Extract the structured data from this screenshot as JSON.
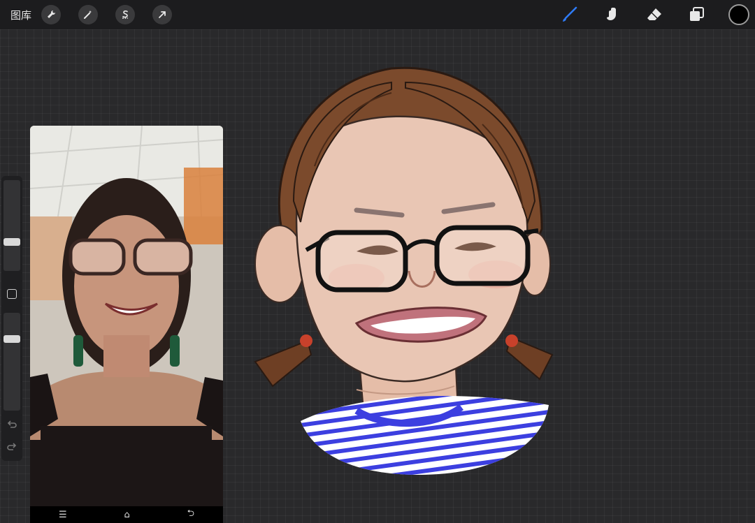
{
  "topbar": {
    "gallery_label": "图库",
    "left_tools": [
      {
        "name": "actions",
        "icon": "wrench-icon"
      },
      {
        "name": "adjustments",
        "icon": "magic-wand-icon"
      },
      {
        "name": "selection",
        "icon": "selection-s-icon"
      },
      {
        "name": "transform",
        "icon": "arrow-cursor-icon"
      }
    ],
    "right_tools": [
      {
        "name": "brush",
        "icon": "brush-icon",
        "active": true
      },
      {
        "name": "smudge",
        "icon": "smudge-icon"
      },
      {
        "name": "eraser",
        "icon": "eraser-icon"
      },
      {
        "name": "layers",
        "icon": "layers-icon"
      }
    ],
    "current_color": "#000000",
    "active_color": "#2f7bf6"
  },
  "sidebar": {
    "brush_size": 0.3,
    "opacity": 0.75
  },
  "reference": {
    "nav": [
      "☰",
      "⌂",
      "⮌"
    ]
  },
  "colors": {
    "skin": "#e9c6b4",
    "hair": "#7b4a2c",
    "shirt_blue": "#3c3fe0",
    "lips": "#c0727c"
  }
}
